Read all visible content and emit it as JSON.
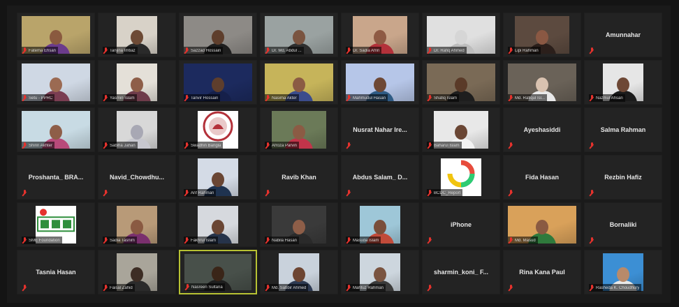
{
  "colors": {
    "background": "#141414",
    "tile": "#232323",
    "active_speaker_border": "#b7c233",
    "muted_mic": "#e5322d"
  },
  "participants": [
    {
      "name": "Fatema Ehsan",
      "video": true,
      "bg": "#b9a46a",
      "skin": "#8a5a3f",
      "cloth": "#6b3b8c",
      "style": "wide"
    },
    {
      "name": "Tanjina Imtiaz",
      "video": true,
      "bg": "#d8d2c8",
      "skin": "#6d4a35",
      "cloth": "#2a2a2a",
      "style": "narrow"
    },
    {
      "name": "Sazzad Hossain",
      "video": true,
      "bg": "#8d8a86",
      "skin": "#5e3e2c",
      "cloth": "#1e1e1e",
      "style": "wide"
    },
    {
      "name": "Dr. Md. Abdul ...",
      "video": true,
      "bg": "#9aa2a1",
      "skin": "#7a5440",
      "cloth": "#2e2e2e",
      "style": "wide"
    },
    {
      "name": "Dr. Sadia Afrin",
      "video": true,
      "bg": "#c9a68b",
      "skin": "#8e5a44",
      "cloth": "#b3313a",
      "style": "mid"
    },
    {
      "name": "Dr. Rafiq Ahmed",
      "video": true,
      "bg": "#e0e0e0",
      "skin": "#d6d6d6",
      "cloth": "#bdbdbd",
      "style": "wide"
    },
    {
      "name": "Lipi Rahman",
      "video": true,
      "bg": "#5c4a3f",
      "skin": "#8a5843",
      "cloth": "#2b1f1b",
      "style": "mid"
    },
    {
      "name": "Amunnahar",
      "video": false
    },
    {
      "name": "Setu - PPRC",
      "video": true,
      "bg": "#cfd8e4",
      "skin": "#9b6a52",
      "cloth": "#7a3d52",
      "style": "wide"
    },
    {
      "name": "Yasmin Islam",
      "video": true,
      "bg": "#e4e0d8",
      "skin": "#8e5e48",
      "cloth": "#6e3b4a",
      "style": "narrow"
    },
    {
      "name": "Tanvir Hossain",
      "video": true,
      "bg": "#1c2a5e",
      "skin": "#5e3e2c",
      "cloth": "#16204a",
      "style": "wide"
    },
    {
      "name": "Nasima Akter",
      "video": true,
      "bg": "#c6b45a",
      "skin": "#8b5b44",
      "cloth": "#3b4c8c",
      "style": "wide"
    },
    {
      "name": "Mahmudul Hasan",
      "video": true,
      "bg": "#b6c6e8",
      "skin": "#6e4835",
      "cloth": "#2f5b84",
      "style": "wide"
    },
    {
      "name": "Shafiq Islam",
      "video": true,
      "bg": "#7a6a56",
      "skin": "#5a3a28",
      "cloth": "#1e1e1e",
      "style": "wide"
    },
    {
      "name": "Md. Rafiqul Isl...",
      "video": true,
      "bg": "#6a6258",
      "skin": "#d9c2b0",
      "cloth": "#e8e8e8",
      "style": "wide"
    },
    {
      "name": "Nazmul Ahsan",
      "video": true,
      "bg": "#e6e6e6",
      "skin": "#6e4835",
      "cloth": "#1b1b1b",
      "style": "narrow"
    },
    {
      "name": "Shirin Akhter",
      "video": true,
      "bg": "#c8dbe4",
      "skin": "#8e5e48",
      "cloth": "#b84a7a",
      "style": "wide"
    },
    {
      "name": "Sabiha Jahan",
      "video": true,
      "bg": "#d8d8d8",
      "skin": "#a8a8b4",
      "cloth": "#c7c7cf",
      "style": "narrow"
    },
    {
      "name": "Swadhin Bangla",
      "video": true,
      "logo": "seal",
      "style": "narrow"
    },
    {
      "name": "Afroza Parvin",
      "video": true,
      "bg": "#6b7a58",
      "skin": "#8b5b44",
      "cloth": "#c2344a",
      "style": "mid"
    },
    {
      "name": "Nusrat Nahar Ire...",
      "video": false
    },
    {
      "name": "Baharul Islam",
      "video": true,
      "bg": "#e8e8e8",
      "skin": "#6a4634",
      "cloth": "#f2f2f2",
      "style": "mid"
    },
    {
      "name": "Ayeshasiddi",
      "video": false
    },
    {
      "name": "Salma Rahman",
      "video": false
    },
    {
      "name": "Proshanta_ BRA...",
      "video": false
    },
    {
      "name": "Navid_Chowdhu...",
      "video": false
    },
    {
      "name": "Arif Rahman",
      "video": true,
      "bg": "#d4dbe6",
      "skin": "#6a4634",
      "cloth": "#1f3350",
      "style": "narrow"
    },
    {
      "name": "Ravib Khan",
      "video": false
    },
    {
      "name": "Abdus Salam_ D...",
      "video": false
    },
    {
      "name": "BCDC_Report",
      "video": true,
      "logo": "ring",
      "style": "narrow"
    },
    {
      "name": "Fida Hasan",
      "video": false
    },
    {
      "name": "Rezbin Hafiz",
      "video": false
    },
    {
      "name": "SME Foundation",
      "video": true,
      "logo": "sme",
      "style": "narrow"
    },
    {
      "name": "Sadia Tasnim",
      "video": true,
      "bg": "#b89a78",
      "skin": "#8a5a42",
      "cloth": "#7a2f6e",
      "style": "narrow"
    },
    {
      "name": "Fakhrul Islam",
      "video": true,
      "bg": "#d6d9de",
      "skin": "#6a4634",
      "cloth": "#26334a",
      "style": "narrow"
    },
    {
      "name": "Nabila Hasan",
      "video": true,
      "bg": "#3a3a3a",
      "skin": "#8e5e48",
      "cloth": "#2a2a2a",
      "style": "mid"
    },
    {
      "name": "Masuda Islam",
      "video": true,
      "bg": "#9ec7d8",
      "skin": "#7a4e3a",
      "cloth": "#c14b3a",
      "style": "narrow"
    },
    {
      "name": "iPhone",
      "video": false
    },
    {
      "name": "Md. Masud",
      "video": true,
      "bg": "#d9a15a",
      "skin": "#8a5a42",
      "cloth": "#2f7a3c",
      "style": "wide"
    },
    {
      "name": "Bornaliki",
      "video": false
    },
    {
      "name": "Tasnia Hasan",
      "video": false
    },
    {
      "name": "Faisal Zahid",
      "video": true,
      "bg": "#a9a59a",
      "skin": "#3d2d24",
      "cloth": "#2b2b2b",
      "style": "narrow"
    },
    {
      "name": "Nasreen Sultana",
      "video": true,
      "bg": "#48504a",
      "skin": "#3a2518",
      "cloth": "#1e1e1e",
      "style": "wide",
      "active": true
    },
    {
      "name": "Md. Sabbir Ahmed",
      "video": true,
      "bg": "#c9d2dc",
      "skin": "#6d4532",
      "cloth": "#2d3a52",
      "style": "narrow"
    },
    {
      "name": "Mahfuz Rahman",
      "video": true,
      "bg": "#cdd6de",
      "skin": "#7a5440",
      "cloth": "#3a3a3a",
      "style": "narrow"
    },
    {
      "name": "sharmin_koni_ F...",
      "video": false
    },
    {
      "name": "Rina Kana Paul",
      "video": false
    },
    {
      "name": "Rasheda K. Choudhury",
      "video": true,
      "bg": "#3c8fd4",
      "skin": "#b88a6a",
      "cloth": "#e8e8e8",
      "style": "narrow"
    }
  ]
}
